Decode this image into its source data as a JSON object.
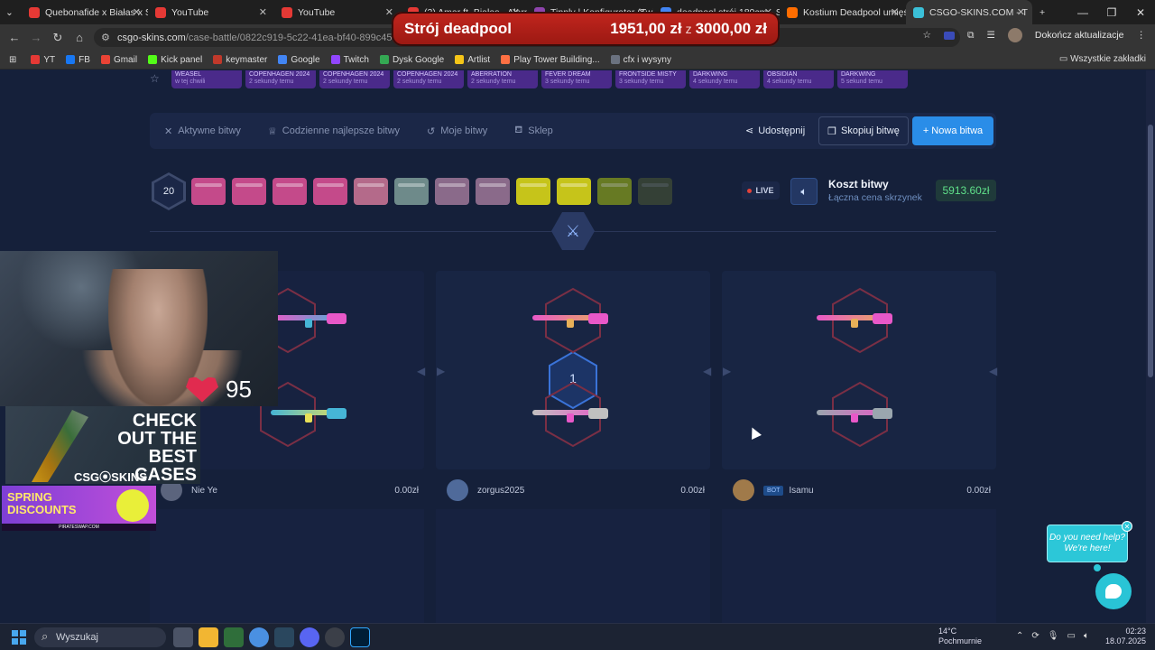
{
  "browser": {
    "tabs": [
      {
        "label": "Quebonafide x Białas x Sz",
        "color": "#e53935"
      },
      {
        "label": "YouTube",
        "color": "#e53935"
      },
      {
        "label": "YouTube",
        "color": "#e53935"
      },
      {
        "label": "(2) Amar ft. Białas - Alarm",
        "color": "#e53935"
      },
      {
        "label": "Tipply | Konfigurator (Twi",
        "color": "#8e44ad"
      },
      {
        "label": "deadpool strój 180cm - S",
        "color": "#4285f4"
      },
      {
        "label": "Kostium Deadpool umięś",
        "color": "#ff6d00"
      },
      {
        "label": "CSGO-SKINS.COM - T",
        "color": "#3bc0d8"
      }
    ],
    "url_host": "csgo-skins.com",
    "url_path": "/case-battle/0822c919-5c22-41ea-bf40-899c450e4991",
    "update_label": "Dokończ aktualizacje",
    "bookmarks": [
      {
        "label": "YT",
        "color": "#e53935"
      },
      {
        "label": "FB",
        "color": "#1877f2"
      },
      {
        "label": "Gmail",
        "color": "#ea4335"
      },
      {
        "label": "Kick panel",
        "color": "#53fc18"
      },
      {
        "label": "keymaster",
        "color": "#c0392b"
      },
      {
        "label": "Google",
        "color": "#4285f4"
      },
      {
        "label": "Twitch",
        "color": "#9146ff"
      },
      {
        "label": "Dysk Google",
        "color": "#34a853"
      },
      {
        "label": "Artlist",
        "color": "#f5c518"
      },
      {
        "label": "Play Tower Building...",
        "color": "#ff7043"
      },
      {
        "label": "cfx i wysyny",
        "color": "#6b7280"
      }
    ],
    "bookmarks_all": "Wszystkie zakładki"
  },
  "overlay": {
    "name": "Strój deadpool",
    "current": "1951,00 zł",
    "of": "z",
    "goal": "3000,00 zł"
  },
  "case_strip": [
    {
      "name": "WEASEL",
      "sub": "w tej chwili"
    },
    {
      "name": "COPENHAGEN 2024",
      "sub": "2 sekundy temu"
    },
    {
      "name": "COPENHAGEN 2024",
      "sub": "2 sekundy temu"
    },
    {
      "name": "COPENHAGEN 2024",
      "sub": "2 sekundy temu"
    },
    {
      "name": "ABERRATION",
      "sub": "2 sekundy temu"
    },
    {
      "name": "FEVER DREAM",
      "sub": "3 sekundy temu"
    },
    {
      "name": "FRONTSIDE MISTY",
      "sub": "3 sekundy temu"
    },
    {
      "name": "DARKWING",
      "sub": "4 sekundy temu"
    },
    {
      "name": "OBSIDIAN",
      "sub": "4 sekundy temu"
    },
    {
      "name": "DARKWING",
      "sub": "5 sekund temu"
    }
  ],
  "menu": {
    "active": "Aktywne bitwy",
    "daily": "Codzienne najlepsze bitwy",
    "mine": "Moje bitwy",
    "shop": "Sklep",
    "share": "Udostępnij",
    "copy": "Skopiuj bitwę",
    "new": "+ Nowa bitwa"
  },
  "battle": {
    "rounds": "20",
    "live": "LIVE",
    "cost_title": "Koszt bitwy",
    "cost_sub": "Łączna cena skrzynek",
    "cost_value": "5913.60zł",
    "current_round": "1",
    "case_colors": [
      "#c44a8a",
      "#c44a8a",
      "#c44a8a",
      "#c44a8a",
      "#b46a8a",
      "#6e8a8a",
      "#8a6a8a",
      "#8a6a8a",
      "#c6c41a",
      "#c6c41a",
      "#8aa01a",
      "#6e7d30"
    ]
  },
  "players": [
    {
      "name": "Nie Ye",
      "value": "0.00zł",
      "bot": ""
    },
    {
      "name": "zorgus2025",
      "value": "0.00zł",
      "bot": ""
    },
    {
      "name": "Isamu",
      "value": "0.00zł",
      "bot": "BOT"
    }
  ],
  "stream": {
    "heart_rate": "95",
    "ad1_text": "CHECK OUT THE BEST CASES",
    "ad1_brand": "CSG⦿SKINS",
    "ad2_text": "SPRING DISCOUNTS",
    "ad2_footer": "PIRATESWAP.COM"
  },
  "chat": {
    "bubble": "Do you need help? We're here!"
  },
  "taskbar": {
    "search": "Wyszukaj",
    "temp": "14°C",
    "weather": "Pochmurnie",
    "time": "02:23",
    "date": "18.07.2025"
  }
}
